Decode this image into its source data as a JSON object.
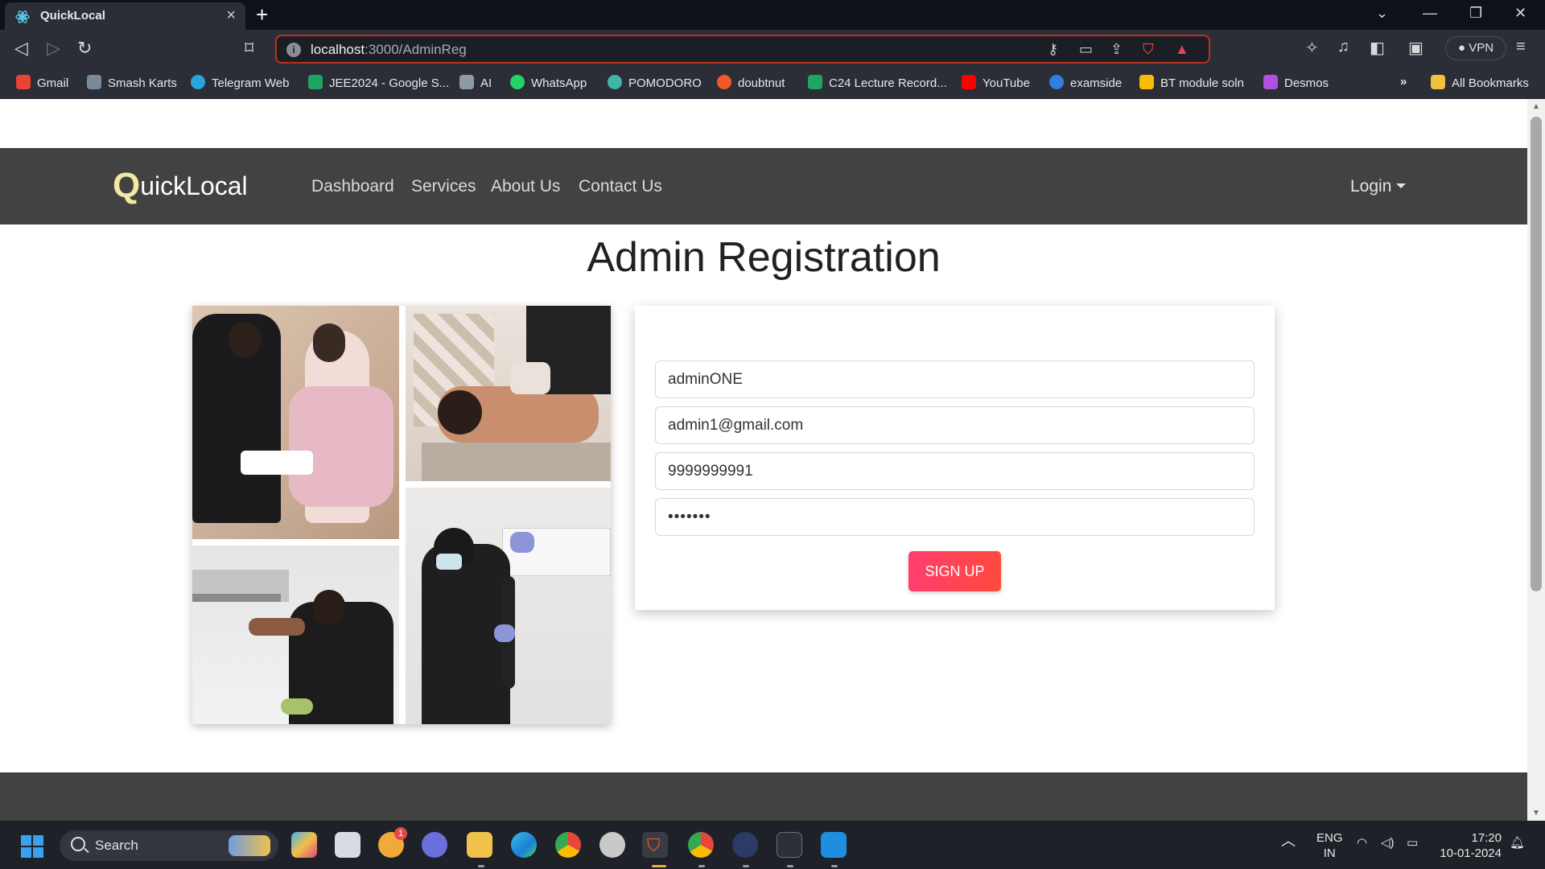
{
  "browser": {
    "tab_title": "QuickLocal",
    "tab_close": "×",
    "new_tab": "+",
    "url_host": "localhost",
    "url_path": ":3000/AdminReg",
    "vpn_label": "VPN",
    "more_bookmarks": "»",
    "bookmarks": [
      {
        "label": "Gmail",
        "color": "#ea4335"
      },
      {
        "label": "Smash Karts",
        "color": "#7a8a99"
      },
      {
        "label": "Telegram Web",
        "color": "#2aa3df"
      },
      {
        "label": "JEE2024 - Google S...",
        "color": "#1fa463"
      },
      {
        "label": "AI",
        "color": "#8e9aa6"
      },
      {
        "label": "WhatsApp",
        "color": "#25d366"
      },
      {
        "label": "POMODORO",
        "color": "#3fb6a8"
      },
      {
        "label": "doubtnut",
        "color": "#f2592a"
      },
      {
        "label": "C24 Lecture Record...",
        "color": "#1fa463"
      },
      {
        "label": "YouTube",
        "color": "#ff0000"
      },
      {
        "label": "examside",
        "color": "#2f7fe0"
      },
      {
        "label": "BT module soln",
        "color": "#fbbc04"
      },
      {
        "label": "Desmos",
        "color": "#b14fe0"
      }
    ],
    "all_bookmarks": "All Bookmarks"
  },
  "site": {
    "brand_initial": "Q",
    "brand_rest": "uickLocal",
    "nav": [
      "Dashboard",
      "Services",
      "About Us",
      "Contact Us"
    ],
    "login": "Login",
    "heading": "Admin Registration"
  },
  "form": {
    "username": "adminONE",
    "email": "admin1@gmail.com",
    "phone": "9999999991",
    "password": "•••••••",
    "submit": "SIGN UP"
  },
  "taskbar": {
    "search": "Search",
    "lang_top": "ENG",
    "lang_bottom": "IN",
    "time": "17:20",
    "date": "10-01-2024",
    "badge_one": "1"
  },
  "colors": {
    "navbar": "#424242",
    "brand_q": "#f2e7a4",
    "signup_gradient_start": "#ff3e6e",
    "signup_gradient_end": "#ff4a3c",
    "address_border": "#b8321f"
  }
}
